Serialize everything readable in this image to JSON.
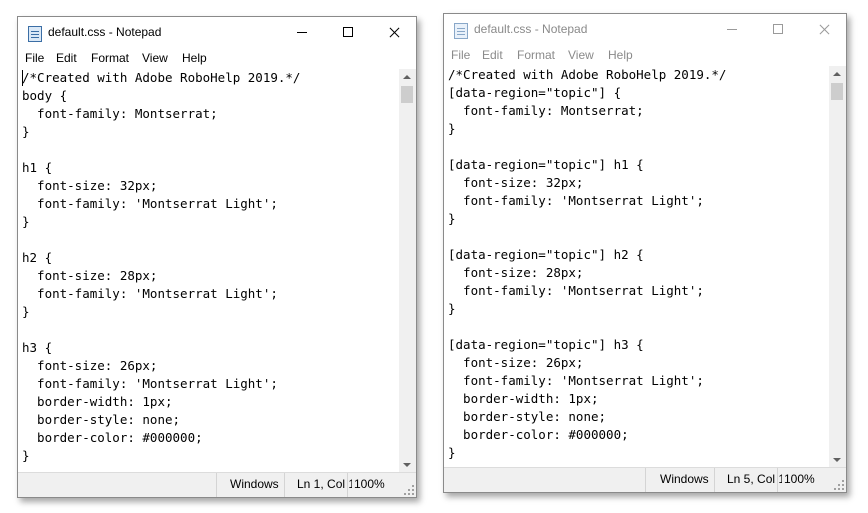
{
  "windows": [
    {
      "title": "default.css - Notepad",
      "active": true,
      "menu": [
        "File",
        "Edit",
        "Format",
        "View",
        "Help"
      ],
      "content": "/*Created with Adobe RoboHelp 2019.*/\nbody {\n  font-family: Montserrat;\n}\n\nh1 {\n  font-size: 32px;\n  font-family: 'Montserrat Light';\n}\n\nh2 {\n  font-size: 28px;\n  font-family: 'Montserrat Light';\n}\n\nh3 {\n  font-size: 26px;\n  font-family: 'Montserrat Light';\n  border-width: 1px;\n  border-style: none;\n  border-color: #000000;\n}",
      "status": {
        "line_ending": "Windows",
        "position": "Ln 1, Col 1",
        "zoom": "100%"
      }
    },
    {
      "title": "default.css - Notepad",
      "active": false,
      "menu": [
        "File",
        "Edit",
        "Format",
        "View",
        "Help"
      ],
      "content": "/*Created with Adobe RoboHelp 2019.*/\n[data-region=\"topic\"] {\n  font-family: Montserrat;\n}\n\n[data-region=\"topic\"] h1 {\n  font-size: 32px;\n  font-family: 'Montserrat Light';\n}\n\n[data-region=\"topic\"] h2 {\n  font-size: 28px;\n  font-family: 'Montserrat Light';\n}\n\n[data-region=\"topic\"] h3 {\n  font-size: 26px;\n  font-family: 'Montserrat Light';\n  border-width: 1px;\n  border-style: none;\n  border-color: #000000;\n}",
      "status": {
        "line_ending": "Windows",
        "position": "Ln 5, Col 1",
        "zoom": "100%"
      }
    }
  ],
  "colors": {
    "window_bg": "#ffffff",
    "chrome": "#f0f0f0",
    "inactive_text": "#8a8a8a",
    "scroll_thumb": "#cdcdcd"
  },
  "icons": {
    "app": "notepad-icon",
    "minimize": "minimize-icon",
    "maximize": "maximize-icon",
    "close": "close-icon"
  }
}
